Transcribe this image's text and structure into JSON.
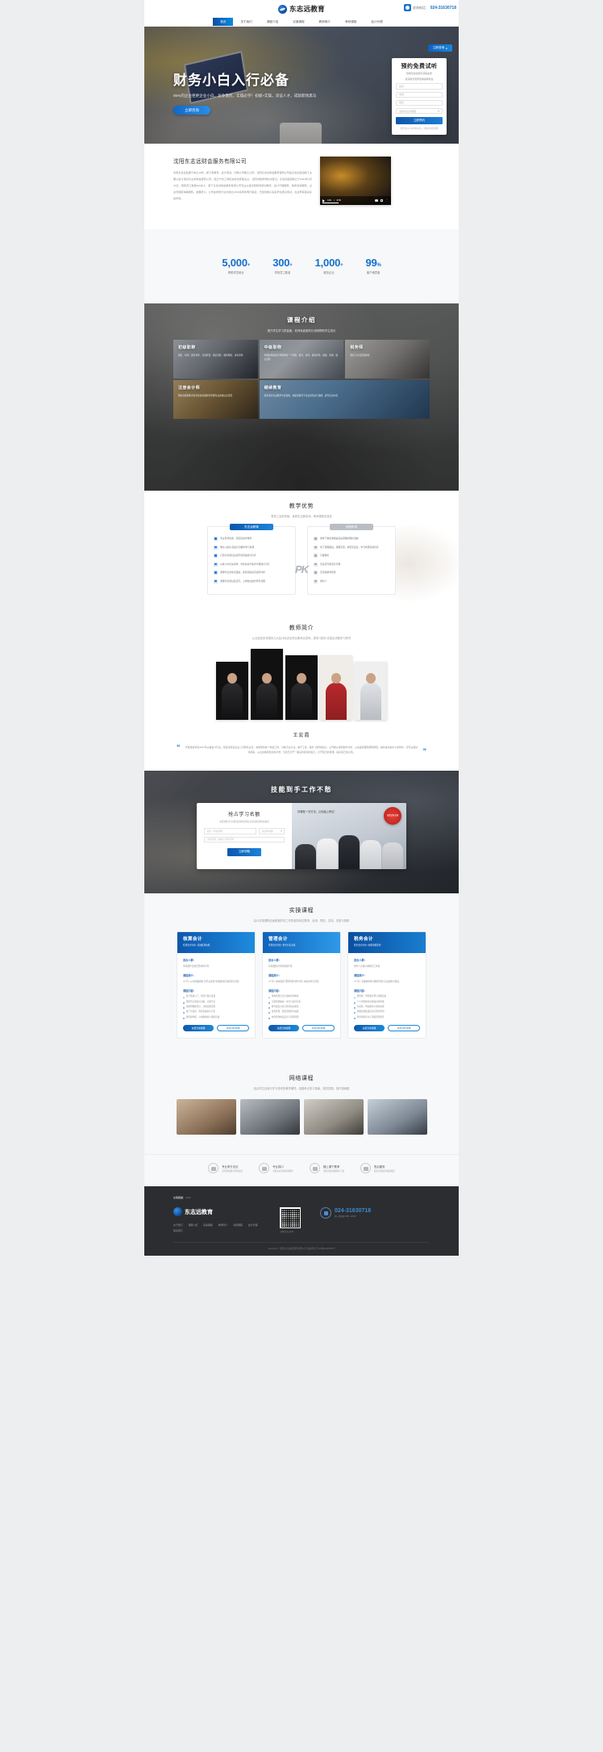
{
  "brand": {
    "logo_text": "东志远教育",
    "logo_icon": "swoosh-logo-icon"
  },
  "header": {
    "phone_label": "咨询电话：",
    "phone_number": "024-31630718",
    "phone_icon": "telephone-icon",
    "consult_tab": "立即咨询",
    "consult_icon": "chevron-right-icon"
  },
  "nav": {
    "items": [
      {
        "label": "首页",
        "active": true
      },
      {
        "label": "关于我们",
        "active": false
      },
      {
        "label": "课程介绍",
        "active": false
      },
      {
        "label": "实操课程",
        "active": false
      },
      {
        "label": "教师简介",
        "active": false
      },
      {
        "label": "考研课程",
        "active": false
      },
      {
        "label": "会计代理",
        "active": false
      }
    ]
  },
  "hero": {
    "title": "财务小白入行必备",
    "subtitle": "85%的企业拒绝企业小白，竞争激烈，实操必学！初级+实操，双证人才，成就职场黑马",
    "button": "立即咨询",
    "form": {
      "title": "预约免费试听",
      "desc_line1": "现填写信息即可获得免费",
      "desc_line2": "资深财务老师咨询指导机会",
      "fields": [
        {
          "name": "name",
          "placeholder": "姓名"
        },
        {
          "name": "phone",
          "placeholder": "电话"
        },
        {
          "name": "area",
          "placeholder": "地区"
        }
      ],
      "select": {
        "placeholder": "选择关注的课程",
        "icon": "chevron-down-icon"
      },
      "submit": "立即预约",
      "note": "我们会24小时内联系您，请保持电话通畅"
    }
  },
  "about": {
    "title": "沈阳东志远财会服务有限公司",
    "paragraph": "沈阳东志远集团于成立10年，旗下有教育、会计培训、代账公司等子公司。沈阳东志远财会服务有限公司是东志远集团旗下主要以会计培训为主的财会服务公司，经辽宁省工商机关依法核准设立，沈阳市税务局依法登记。东志远集团成立于2002年4月25日，现有员工数量300余人，旗下东志远财会服务有限公司专业从事沈阳财务培训教育、会计代理服务、税务咨询服务、企业管理咨询等服务。发展至今，公司在财务行业内建立1000多家的同行渠道，已经协助众多名学生通过考试，在业界有着良好的声誉。",
    "video": {
      "time_current": "0:00",
      "time_total": "8:55",
      "play_icon": "play-icon",
      "speaker_icon": "speaker-icon",
      "fullscreen_icon": "fullscreen-icon",
      "more_icon": "more-options-icon"
    }
  },
  "stats": {
    "items": [
      {
        "value": "5,000",
        "suffix": "+",
        "label": "帮助学员就业"
      },
      {
        "value": "300",
        "suffix": "+",
        "label": "学校员工数量"
      },
      {
        "value": "1,000",
        "suffix": "+",
        "label": "服务企业"
      },
      {
        "value": "99",
        "suffix": "%",
        "label": "客户满意度"
      }
    ],
    "accent_color": "#1570cb"
  },
  "courses": {
    "title": "课程介绍",
    "subtitle": "提升学生学习质量度，老师免费服务长领域帮助学生成长",
    "cards": [
      {
        "name": "初级职称",
        "desc": "报名、时间、报考条件、考试科目、取证流程、报名网址、免考条件"
      },
      {
        "name": "中级职称",
        "desc": "中级职称是会计师职称的一个等级，报考、时间、报名条件、成绩、查询、取证流程"
      },
      {
        "name": "税务师",
        "desc": "报名与考试流程解析"
      },
      {
        "name": "注册会计师",
        "desc": "国内高级职称考察考核的高级财务管理专业资格认证项目"
      },
      {
        "name": "继续教育",
        "desc": "每年通过专业教学方式进修，快速掌握至今专业新知识与技能，提升自身价值"
      }
    ]
  },
  "advantage": {
    "title": "教学优势",
    "subtitle": "表现工会机构相、素质定位服务师、教师课程实操性",
    "badge": "PK",
    "left": {
      "tag": "东志远教育",
      "items": [
        "专业老师授课，项目实操带教学",
        "理论+案例+实操全流程中学习效果",
        "只需考试通过业绩带领实操能力培养",
        "从教小时长免指导，考核并提升事务代理建议可行",
        "课程考试合格全面进，提供实操真实案例分析",
        "课程考试通过后还可，上岗独立操作所有流程"
      ]
    },
    "right": {
      "tag": "其他机构",
      "items": [
        "课堂下教授课程是实操课程的理论讲解",
        "线下课程跟进，课程无限，效果无连接，学习效果完成培养",
        "只做理论",
        "无真实代账实务代理",
        "无实操教学经验",
        "课时少"
      ]
    }
  },
  "teachers": {
    "title": "教师简介",
    "subtitle": "从业经验多年国内几大会计培训业知名教师全讲师，提供+成熟+实操全流程学习研究",
    "photos": [
      "teacher-photo-1",
      "teacher-photo-2",
      "teacher-photo-3",
      "teacher-photo-4",
      "teacher-photo-5"
    ],
    "name": "王宏霞",
    "quote_icon_left": "quote-open-icon",
    "quote_icon_right": "quote-close-icon",
    "quote": "代账经验丰富2007年从事会计行业，担任某知名企业公司财务主管，熟悉财务各个岗位工作，对各行业户过，擅于工商、税务《财务报表》，从开始从重到财务分析，从资金管理到预算审核，擅长各出各中小新财务，带专业和好评起来，从业资格有较高的声誉，为自己打开一路设有思索的窗口，打开自己的思维，提高自己的认知。"
  },
  "cta": {
    "title": "技能到手工作不愁",
    "card": {
      "heading": "抢占学习名额",
      "line": "免费领取学习资料及课程优惠信息名额有限抢先报名",
      "fields": [
        {
          "name": "name",
          "placeholder": "姓名 / 例如张明"
        },
        {
          "name": "course",
          "placeholder": "请选择课程",
          "icon": "chevron-down-icon"
        },
        {
          "name": "phone",
          "placeholder": "手机号码 / 请输入手机号码"
        }
      ],
      "submit": "立即领取",
      "promo_tag": "好课程 + 好方法，让你赢上岸位！",
      "seal": "免费试听名额"
    }
  },
  "practice": {
    "title": "实操课程",
    "subtitle": "会计实操课程全面覆盖财务工作的各类岗位需求，全用、理论、实操、实账与报税",
    "cards": [
      {
        "name": "核算会计",
        "sub": "核算会计岗位 / 基础核算技能",
        "target_label": "适合人群：",
        "target_text": "零基础学员或无经验转行者",
        "content_label": "课程简介：",
        "content_text": "3个月 / 从零基础建账 到凭证处理 零基础到日常核算全流程",
        "outline_label": "课程内容：",
        "outline": [
          "会计基础入门、科目与账户设置",
          "原始凭证填制与审核、记账凭证",
          "总账明细账登记、对账结账流程",
          "资产负债表、利润表编制与分析",
          "增值税申报、小规模纳税人报税实操"
        ],
        "btn_primary": "免费咨询课程",
        "btn_secondary": "免费试听课程"
      },
      {
        "name": "管理会计",
        "sub": "管理会计岗位 / 财务分析决策",
        "target_label": "适合人群：",
        "target_text": "有基础会计经验想提升者",
        "content_label": "课程简介：",
        "content_text": "4个月 / 成本核算 预算管理 财务分析 决策支持全流程",
        "outline_label": "课程内容：",
        "outline": [
          "成本核算方法与成本控制体系",
          "全面预算编制、执行与差异分析",
          "财务报表分析与经营指标解读",
          "资金管理、现金流预测与融资",
          "内部控制制度设计与风险管理"
        ],
        "btn_primary": "免费咨询课程",
        "btn_secondary": "免费试听课程"
      },
      {
        "name": "税务会计",
        "sub": "税务会计岗位 / 纳税申报筹划",
        "target_label": "适合人群：",
        "target_text": "财务人员或从事税务工作者",
        "content_label": "课程简介：",
        "content_text": "3个月 / 全税种申报 到税务筹划 实战案例全覆盖",
        "outline_label": "课程内容：",
        "outline": [
          "增值税、所得税计算与申报实操",
          "个人所得税专项附加扣除申报",
          "印花税、附加税等小税种处理",
          "税收优惠政策应用与税务筹划",
          "税务稽查应对与涉税风险防范"
        ],
        "btn_primary": "免费咨询课程",
        "btn_secondary": "免费试听课程"
      }
    ]
  },
  "online": {
    "title": "网络课程",
    "subtitle": "结合学生自身与学习带来的教学辅导，真题考点的习指南，提供答疑，操作指南题",
    "thumbs": [
      "online-course-thumb-1",
      "online-course-thumb-2",
      "online-course-thumb-3",
      "online-course-thumb-4"
    ]
  },
  "features": {
    "items": [
      {
        "icon": "shield-icon",
        "title": "专业考方法论",
        "sub": "多年累积教学经验总结"
      },
      {
        "icon": "certificate-icon",
        "title": "专业真口",
        "sub": "全职专业老师授课教学"
      },
      {
        "icon": "download-icon",
        "title": "随上课下载考",
        "sub": "资料免费领取随时下载"
      },
      {
        "icon": "service-icon",
        "title": "售后服务",
        "sub": "终身免费复训答疑服务"
      }
    ]
  },
  "footer": {
    "friend_link_label": "友情链接：",
    "friend_link_text": "LINK",
    "logo_text": "东志远教育",
    "nav": [
      "关于我们",
      "课程介绍",
      "实操课程",
      "教师简介",
      "考研课程",
      "会计代理",
      "联系我们"
    ],
    "qr_label": "扫码关注公众号",
    "tel_number": "024-31630718",
    "tel_sub": "周一至周日 8:00 - 20:00",
    "copyright": "Copyright © 沈阳东志远财会服务有限公司 版权所有  辽ICP备12345678号"
  }
}
